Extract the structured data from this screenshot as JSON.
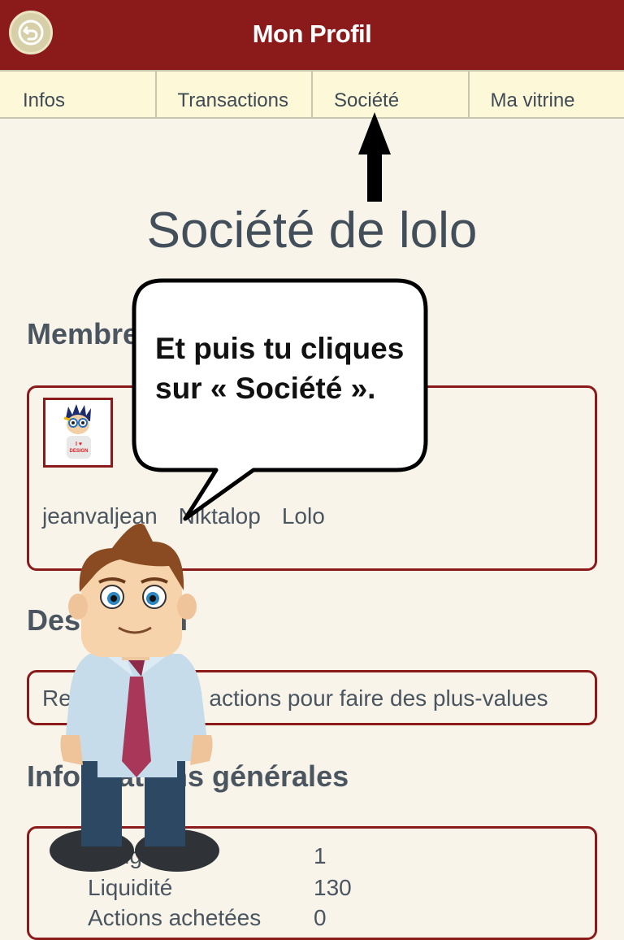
{
  "header": {
    "title": "Mon Profil",
    "back_icon": "back-arrow-icon"
  },
  "tabs": [
    {
      "label": "Infos"
    },
    {
      "label": "Transactions"
    },
    {
      "label": "Société"
    },
    {
      "label": "Ma vitrine"
    }
  ],
  "company": {
    "title": "Société de lolo"
  },
  "members_section": {
    "title": "Membres",
    "members": [
      "jeanvaljean",
      "Niktalop",
      "Lolo"
    ]
  },
  "description_section": {
    "title": "Description",
    "text": "Rechercher des actions pour faire des plus-values"
  },
  "general_info_section": {
    "title": "Informations générales",
    "rows": [
      {
        "label": "Rang",
        "value": "1"
      },
      {
        "label": "Liquidité",
        "value": "130"
      },
      {
        "label": "Actions achetées",
        "value": "0"
      }
    ]
  },
  "tutorial": {
    "bubble_text_line1": "Et puis tu cliques",
    "bubble_text_line2": "sur « Société ».",
    "avatar_badge": "I ♥ DESIGN"
  },
  "colors": {
    "header": "#8b1a1a",
    "background": "#f8f4ea",
    "tabs": "#fdf8d8"
  }
}
